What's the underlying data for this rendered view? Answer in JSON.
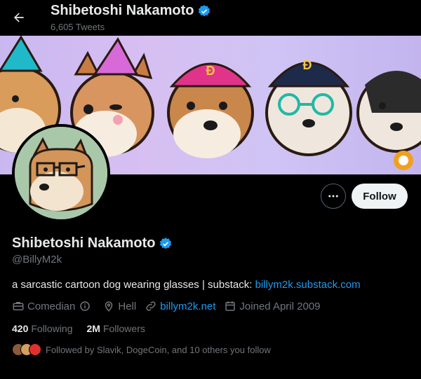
{
  "header": {
    "name": "Shibetoshi Nakamoto",
    "tweets": "6,605 Tweets"
  },
  "profile": {
    "name": "Shibetoshi Nakamoto",
    "handle": "@BillyM2k",
    "bio_text": "a sarcastic cartoon dog wearing glasses | substack: ",
    "bio_link": "billym2k.substack.com",
    "category": "Comedian",
    "location": "Hell",
    "website": "billym2k.net",
    "joined": "Joined April 2009"
  },
  "counts": {
    "following_value": "420",
    "following_label": "Following",
    "followers_value": "2M",
    "followers_label": "Followers"
  },
  "followed_by": "Followed by Slavik, DogeCoin, and 10 others you follow",
  "actions": {
    "follow_label": "Follow"
  },
  "colors": {
    "accent": "#1d9bf0",
    "background": "#000000",
    "banner": "#cfc0f3",
    "avatar_bg": "#a9c8a9"
  },
  "icons": [
    "back-arrow-icon",
    "verified-badge-icon",
    "more-icon",
    "briefcase-icon",
    "info-icon",
    "location-pin-icon",
    "link-icon",
    "calendar-icon"
  ]
}
